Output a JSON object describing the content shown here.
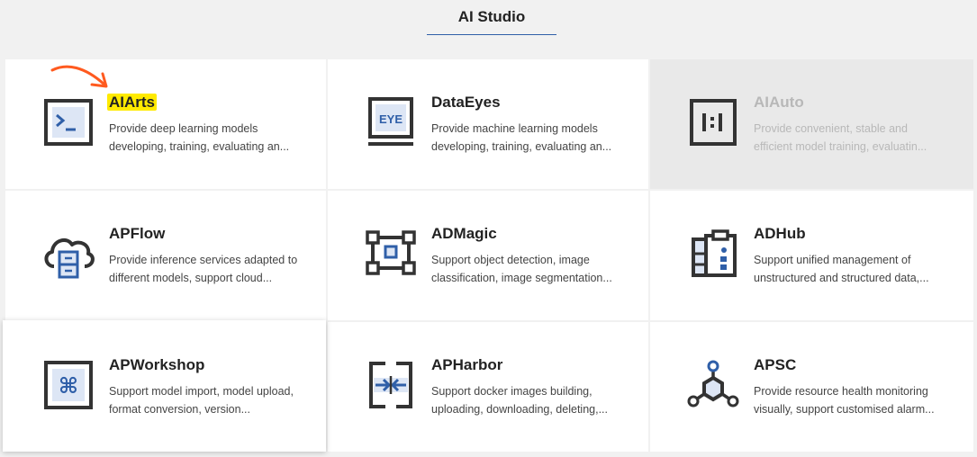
{
  "header": {
    "title": "AI Studio"
  },
  "cards": [
    {
      "name": "AIArts",
      "description": "Provide deep learning models developing, training, evaluating an...",
      "icon": "terminal-icon"
    },
    {
      "name": "DataEyes",
      "description": "Provide machine learning models developing, training, evaluating an...",
      "icon": "eye-monitor-icon",
      "icon_text": "EYE"
    },
    {
      "name": "AIAuto",
      "description": "Provide convenient, stable and efficient model training, evaluatin...",
      "icon": "auto-box-icon",
      "icon_text": "I:I",
      "disabled": true
    },
    {
      "name": "APFlow",
      "description": "Provide inference services adapted to different models, support cloud...",
      "icon": "cloud-server-icon"
    },
    {
      "name": "ADMagic",
      "description": "Support object detection, image classification, image segmentation...",
      "icon": "bounding-box-icon"
    },
    {
      "name": "ADHub",
      "description": "Support unified management of unstructured and structured data,...",
      "icon": "clipboard-data-icon"
    },
    {
      "name": "APWorkshop",
      "description": "Support model import, model upload, format conversion, version...",
      "icon": "command-key-icon",
      "icon_text": "⌘"
    },
    {
      "name": "APHarbor",
      "description": "Support docker images building, uploading, downloading, deleting,...",
      "icon": "harbor-arrows-icon"
    },
    {
      "name": "APSC",
      "description": "Provide resource health monitoring visually, support customised alarm...",
      "icon": "network-nodes-icon"
    }
  ],
  "colors": {
    "accent": "#2f5fa8",
    "icon_dark": "#333333",
    "icon_fill": "#dde6f5",
    "annotation": "#ff5a1f",
    "highlight": "#ffea00"
  }
}
